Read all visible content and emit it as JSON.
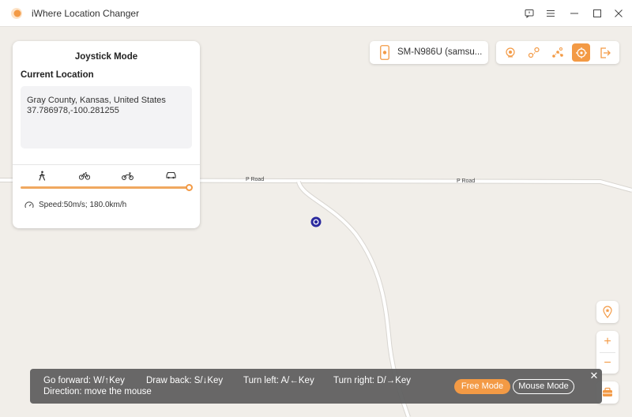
{
  "app": {
    "title": "iWhere Location Changer",
    "accent_color": "#f39a45",
    "window_controls": [
      "feedback-icon",
      "menu-icon",
      "minimize-icon",
      "maximize-icon",
      "close-icon"
    ]
  },
  "panel": {
    "title": "Joystick Mode",
    "current_location_label": "Current Location",
    "address": "Gray County, Kansas, United States",
    "coordinates": "37.786978,-100.281255",
    "modes": [
      "walk-icon",
      "bicycle-icon",
      "motorcycle-icon",
      "car-icon"
    ],
    "speed_fraction": 1.0,
    "speed_text": "Speed:50m/s; 180.0km/h"
  },
  "device": {
    "name": "SM-N986U (samsu..."
  },
  "toolbar": {
    "tools": [
      "teleport-icon",
      "one-stop-route-icon",
      "multi-stop-route-icon",
      "joystick-icon",
      "exit-icon"
    ],
    "active_tool": "joystick-icon"
  },
  "map": {
    "road_labels": [
      "P Road",
      "P Road"
    ]
  },
  "hints": {
    "forward": "Go forward: W/↑Key",
    "back": "Draw back: S/↓Key",
    "left": "Turn left: A/←Key",
    "right": "Turn right: D/→Key",
    "direction": "Direction: move the mouse",
    "free_mode": "Free Mode",
    "mouse_mode": "Mouse Mode"
  },
  "zoom": {
    "plus": "+",
    "minus": "−"
  }
}
